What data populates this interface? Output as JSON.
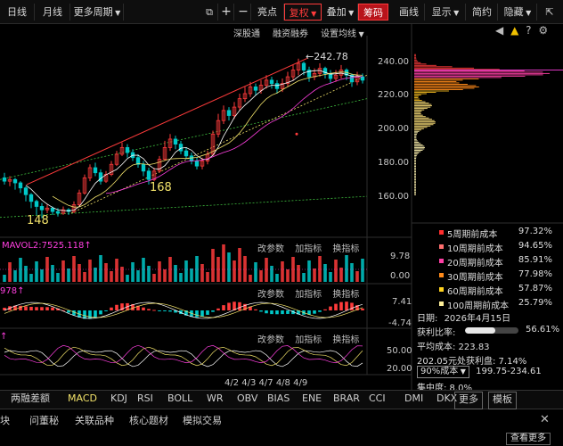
{
  "toolbar": {
    "daily": "日线",
    "monthly": "月线",
    "more_period": "更多周期",
    "highlight": "亮点",
    "restore": "复权",
    "overlay": "叠加",
    "chips": "筹码",
    "draw": "画线",
    "display": "显示",
    "brief": "简约",
    "hide": "隐藏"
  },
  "subtoolbar": {
    "sz": "深股通",
    "margin": "融资融券",
    "ma_setting": "设置均线"
  },
  "price_axis": {
    "ticks": [
      "240.00",
      "220.00",
      "200.00",
      "180.00",
      "160.00"
    ]
  },
  "annotations": {
    "high": "242.78",
    "low1": "148",
    "low2": "168"
  },
  "volume_panel": {
    "label": "MAVOL2:7525.118",
    "tools": [
      "改参数",
      "加指标",
      "换指标"
    ],
    "axis": [
      "9.78",
      "0.00"
    ]
  },
  "macd_panel": {
    "label": "978",
    "tools": [
      "改参数",
      "加指标",
      "换指标"
    ],
    "axis": [
      "7.41",
      "-4.74"
    ]
  },
  "rsi_panel": {
    "tools": [
      "改参数",
      "加指标",
      "换指标"
    ],
    "axis": [
      "50.00",
      "20.00"
    ]
  },
  "date_axis": "4/2 4/3 4/7 4/8 4/9",
  "cost_legend": [
    {
      "name": "5周期前成本",
      "value": "97.32%",
      "color": "#ff2d2d"
    },
    {
      "name": "10周期前成本",
      "value": "94.65%",
      "color": "#ff6f6f"
    },
    {
      "name": "20周期前成本",
      "value": "85.91%",
      "color": "#ff3fa6"
    },
    {
      "name": "30周期前成本",
      "value": "77.98%",
      "color": "#ff8a1a"
    },
    {
      "name": "60周期前成本",
      "value": "57.87%",
      "color": "#ffd21f"
    },
    {
      "name": "100周期前成本",
      "value": "25.79%",
      "color": "#fff09a"
    }
  ],
  "chip_stats": {
    "date_label": "日期:",
    "date": "2026年4月15日",
    "profit_label": "获利比率:",
    "profit_ratio": 0.5661,
    "profit_text": "56.61%",
    "avg_cost": "平均成本: 223.83",
    "profit_at": "202.05元处获利盘: 7.14%",
    "cost_band": "90%成本",
    "cost_range": "199.75-234.61",
    "concentration": "集中度: 8.0%"
  },
  "indicator_tabs": [
    "两融差额",
    "MACD",
    "KDJ",
    "RSI",
    "BOLL",
    "WR",
    "OBV",
    "BIAS",
    "ENE",
    "BRAR",
    "CCI",
    "DMI",
    "DKX",
    "更多",
    "模板"
  ],
  "link_bar": [
    "块",
    "问董秘",
    "关联品种",
    "核心题材",
    "模拟交易"
  ],
  "see_more": "查看更多",
  "colors": {
    "up": "#ff3b3b",
    "down": "#00c8c8",
    "accent": "#ff3b3b"
  },
  "chart_data": {
    "type": "candlestick",
    "yaxis_ticks": [
      160,
      180,
      200,
      220,
      240
    ],
    "ylim": [
      143,
      250
    ],
    "high_marker": 242.78,
    "low_markers": [
      148,
      168
    ],
    "date_ticks": [
      "4/2",
      "4/3",
      "4/7",
      "4/8",
      "4/9"
    ],
    "candles": [
      [
        172,
        170,
        175,
        168
      ],
      [
        170,
        171,
        173,
        167
      ],
      [
        171,
        169,
        172,
        165
      ],
      [
        169,
        166,
        170,
        163
      ],
      [
        166,
        162,
        167,
        158
      ],
      [
        162,
        158,
        163,
        154
      ],
      [
        158,
        155,
        159,
        150
      ],
      [
        155,
        153,
        157,
        148
      ],
      [
        153,
        154,
        156,
        151
      ],
      [
        154,
        152,
        155,
        150
      ],
      [
        152,
        151,
        154,
        149
      ],
      [
        151,
        153,
        155,
        150
      ],
      [
        153,
        152,
        154,
        150
      ],
      [
        152,
        156,
        158,
        151
      ],
      [
        156,
        163,
        165,
        155
      ],
      [
        163,
        172,
        174,
        162
      ],
      [
        172,
        178,
        180,
        170
      ],
      [
        178,
        175,
        181,
        173
      ],
      [
        175,
        170,
        177,
        168
      ],
      [
        170,
        174,
        176,
        169
      ],
      [
        174,
        180,
        182,
        173
      ],
      [
        180,
        186,
        188,
        179
      ],
      [
        186,
        190,
        193,
        185
      ],
      [
        190,
        187,
        192,
        184
      ],
      [
        187,
        184,
        189,
        182
      ],
      [
        184,
        180,
        186,
        178
      ],
      [
        180,
        176,
        182,
        173
      ],
      [
        176,
        171,
        178,
        168
      ],
      [
        171,
        176,
        178,
        170
      ],
      [
        176,
        183,
        185,
        175
      ],
      [
        183,
        190,
        194,
        182
      ],
      [
        190,
        195,
        198,
        188
      ],
      [
        195,
        192,
        197,
        189
      ],
      [
        192,
        188,
        194,
        186
      ],
      [
        188,
        185,
        190,
        183
      ],
      [
        185,
        182,
        187,
        180
      ],
      [
        182,
        179,
        184,
        177
      ],
      [
        179,
        182,
        184,
        177
      ],
      [
        182,
        186,
        188,
        180
      ],
      [
        186,
        198,
        200,
        185
      ],
      [
        198,
        206,
        210,
        196
      ],
      [
        206,
        212,
        215,
        204
      ],
      [
        212,
        209,
        214,
        206
      ],
      [
        209,
        214,
        217,
        207
      ],
      [
        214,
        219,
        222,
        212
      ],
      [
        219,
        222,
        226,
        217
      ],
      [
        222,
        226,
        229,
        220
      ],
      [
        226,
        224,
        228,
        221
      ],
      [
        224,
        227,
        230,
        222
      ],
      [
        227,
        230,
        233,
        225
      ],
      [
        230,
        228,
        232,
        225
      ],
      [
        228,
        225,
        230,
        222
      ],
      [
        225,
        228,
        231,
        223
      ],
      [
        228,
        232,
        235,
        226
      ],
      [
        232,
        236,
        239,
        230
      ],
      [
        236,
        240,
        242.78,
        233
      ],
      [
        240,
        236,
        241,
        233
      ],
      [
        236,
        232,
        238,
        229
      ],
      [
        232,
        234,
        237,
        230
      ],
      [
        234,
        237,
        240,
        232
      ],
      [
        237,
        234,
        238,
        231
      ],
      [
        234,
        231,
        236,
        228
      ],
      [
        231,
        233,
        236,
        229
      ],
      [
        233,
        236,
        239,
        231
      ],
      [
        236,
        233,
        237,
        230
      ],
      [
        233,
        229,
        234,
        226
      ],
      [
        229,
        232,
        235,
        227
      ],
      [
        232,
        230,
        234,
        228
      ]
    ]
  }
}
